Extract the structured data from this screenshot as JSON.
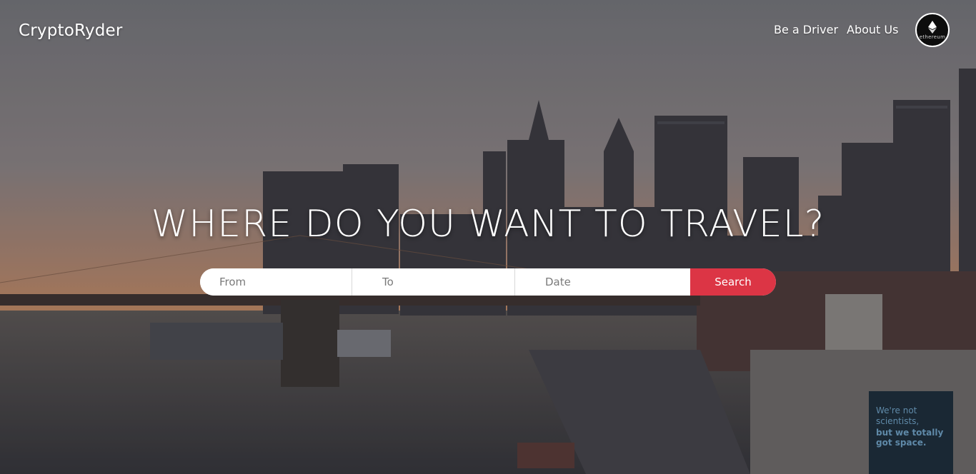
{
  "brand": {
    "name": "CryptoRyder"
  },
  "nav": {
    "driver_label": "Be a Driver",
    "about_label": "About Us",
    "ethereum_label": "ethereum",
    "ethereum_icon": "ethereum-diamond"
  },
  "hero": {
    "headline": "WHERE DO YOU WANT TO TRAVEL?",
    "billboard": {
      "line1": "We're not",
      "line2": "scientists,",
      "line3": "but we totally",
      "line4": "got space."
    }
  },
  "search": {
    "from_placeholder": "From",
    "to_placeholder": "To",
    "date_placeholder": "Date",
    "button_label": "Search"
  },
  "colors": {
    "accent": "#dc3545",
    "sky_top": "#7a7b80",
    "sky_bottom": "#c88b67",
    "water": "#4a4846"
  }
}
